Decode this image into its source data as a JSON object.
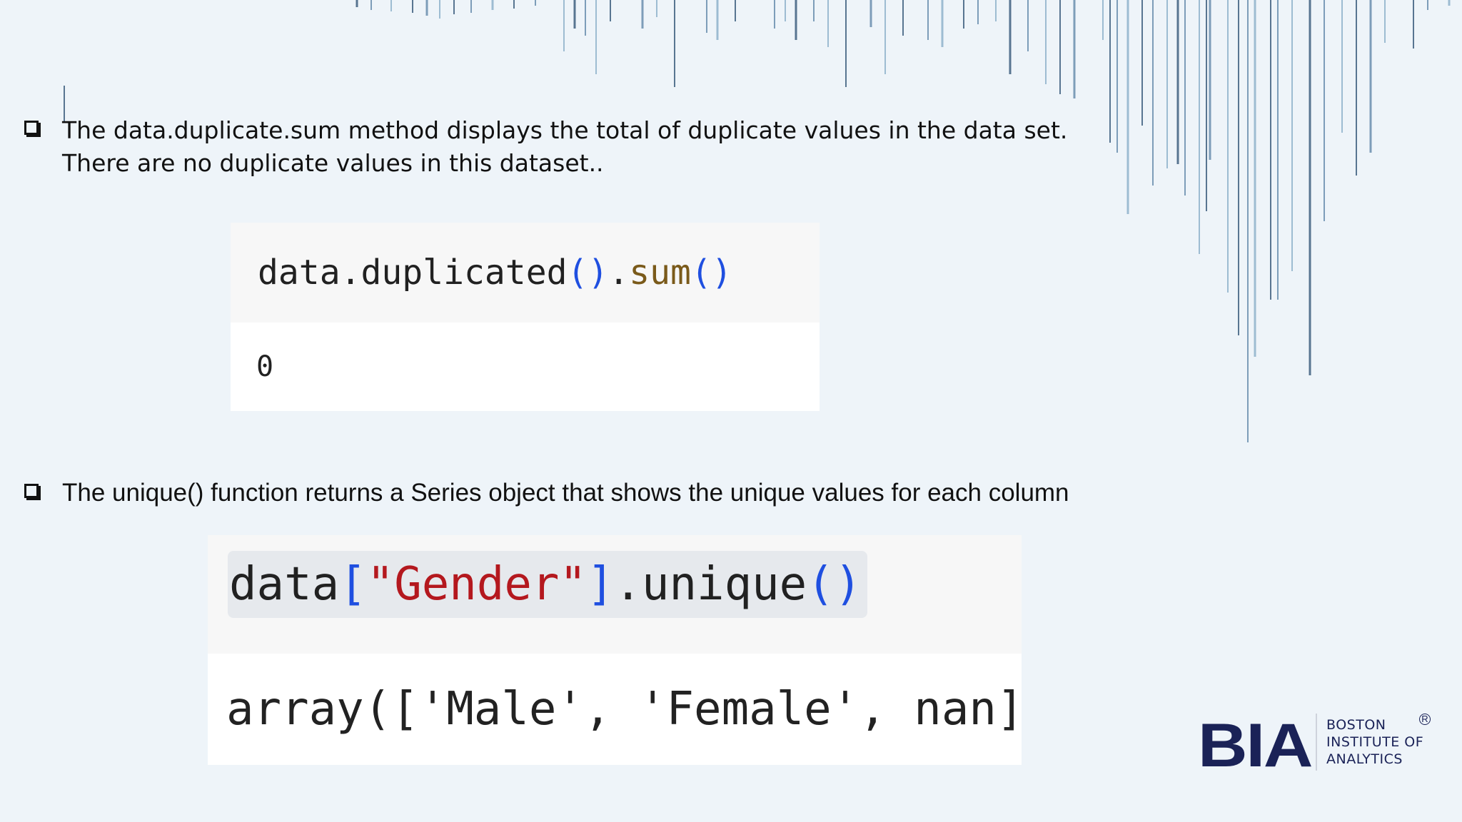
{
  "bullets": [
    {
      "text": "The data.duplicate.sum method displays the total of duplicate values in the data set. There are no duplicate values in this dataset.."
    },
    {
      "text": "The unique() function returns a Series object that shows the unique values for each column"
    }
  ],
  "code_cell_1": {
    "input_obj": "data",
    "input_dot1": ".",
    "input_method1": "duplicated",
    "input_parens1": "()",
    "input_dot2": ".",
    "input_method2": "sum",
    "input_parens2": "()",
    "output": "0"
  },
  "code_cell_2": {
    "input_obj": "data",
    "input_open": "[",
    "input_key": "\"Gender\"",
    "input_close": "]",
    "input_method": ".unique",
    "input_parens": "()",
    "output": "array(['Male', 'Female', nan]"
  },
  "logo": {
    "mark": "BIA",
    "line1": "BOSTON",
    "line2": "INSTITUTE OF",
    "line3": "ANALYTICS",
    "reg": "R"
  },
  "colors": {
    "background": "#eef4f9",
    "brand_navy": "#1a2257",
    "deco_lines": "#4a6a8a"
  }
}
